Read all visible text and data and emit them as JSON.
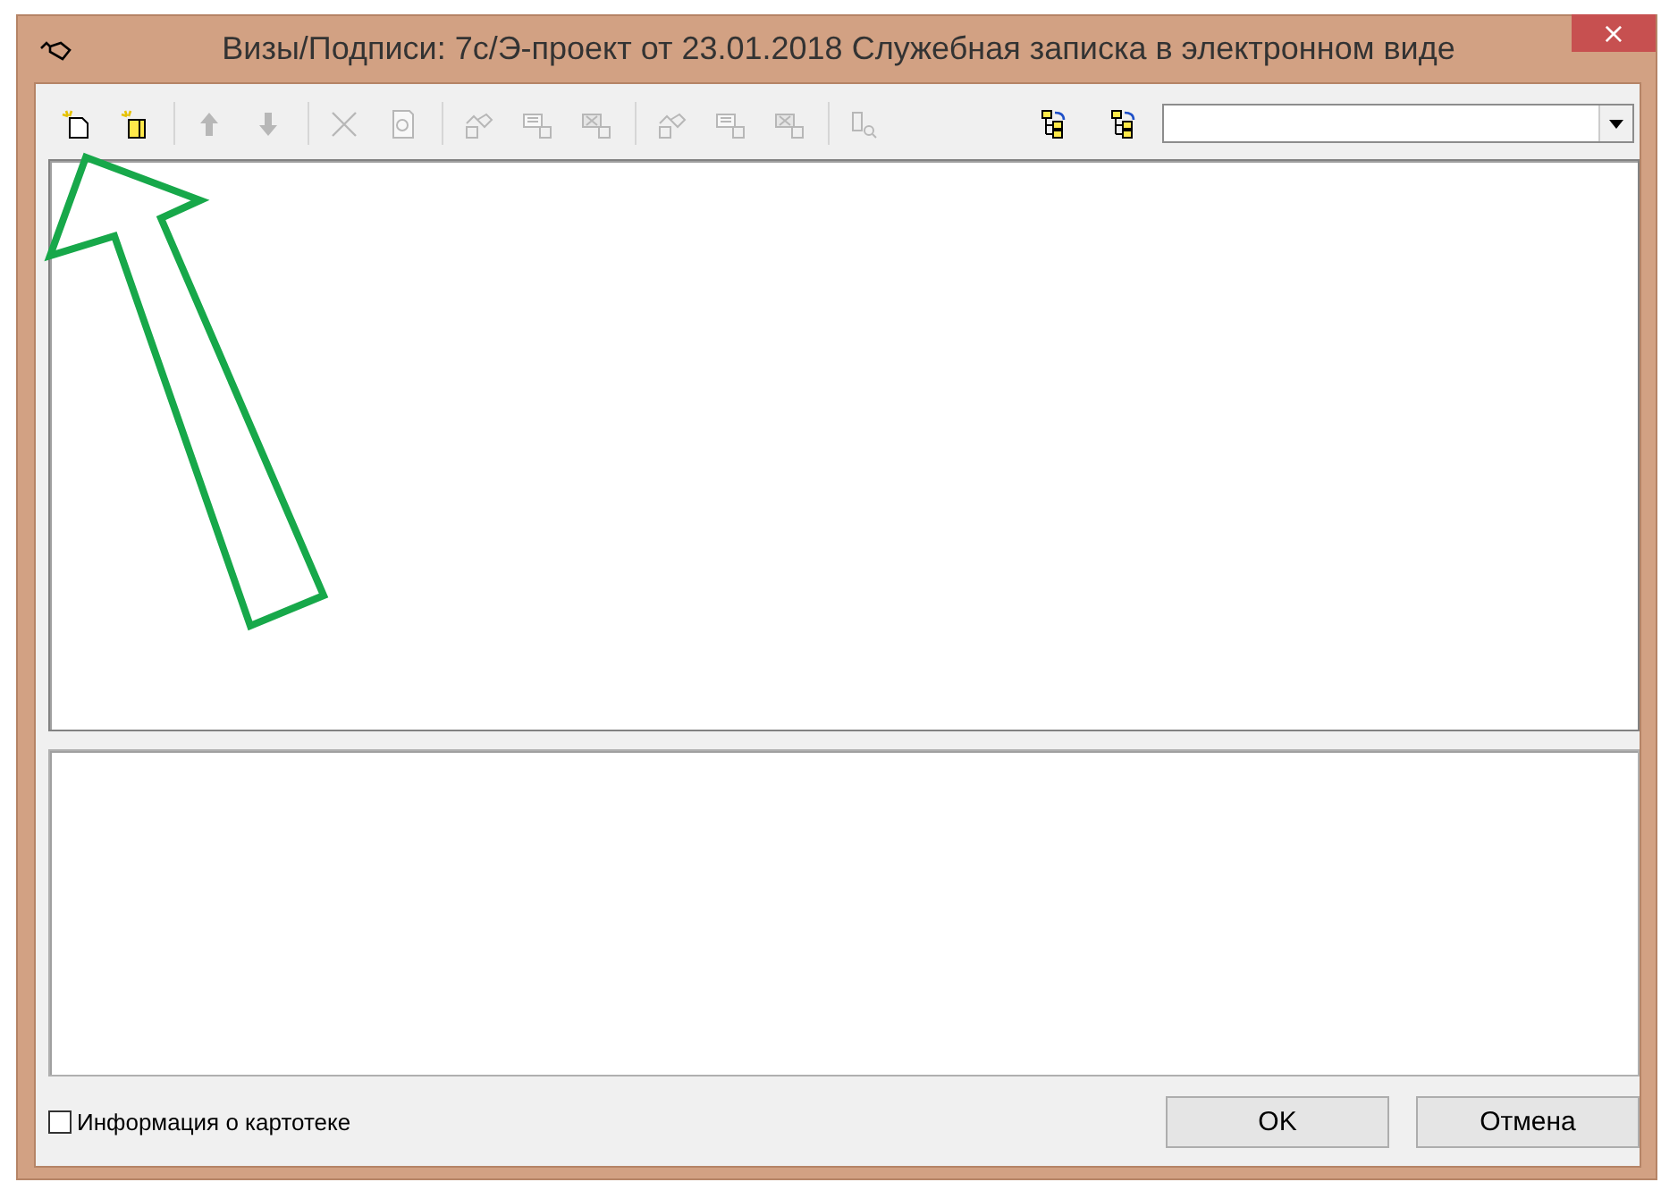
{
  "window": {
    "title": "Визы/Подписи: 7с/Э-проект от 23.01.2018 Служебная записка в электронном виде",
    "close": "×"
  },
  "toolbar": {
    "groups": [
      [
        {
          "kind": "new-doc",
          "disabled": false
        },
        {
          "kind": "new-folder",
          "disabled": false
        }
      ],
      [
        {
          "kind": "up",
          "disabled": true
        },
        {
          "kind": "down",
          "disabled": true
        }
      ],
      [
        {
          "kind": "cut",
          "disabled": true
        },
        {
          "kind": "view",
          "disabled": true
        }
      ],
      [
        {
          "kind": "sign-add",
          "disabled": true
        },
        {
          "kind": "sign-edit",
          "disabled": true
        },
        {
          "kind": "sign-del",
          "disabled": true
        }
      ],
      [
        {
          "kind": "sign-add",
          "disabled": true
        },
        {
          "kind": "sign-edit",
          "disabled": true
        },
        {
          "kind": "sign-del",
          "disabled": true
        }
      ],
      [
        {
          "kind": "find",
          "disabled": true
        }
      ]
    ],
    "tree_buttons": [
      {
        "kind": "tree-down",
        "disabled": false
      },
      {
        "kind": "tree-up",
        "disabled": false
      }
    ]
  },
  "footer": {
    "checkbox": {
      "label": "Информация о картотеке",
      "checked": false
    },
    "buttons": [
      "OK",
      "Отмена"
    ]
  },
  "annotation": {
    "kind": "arrow"
  }
}
